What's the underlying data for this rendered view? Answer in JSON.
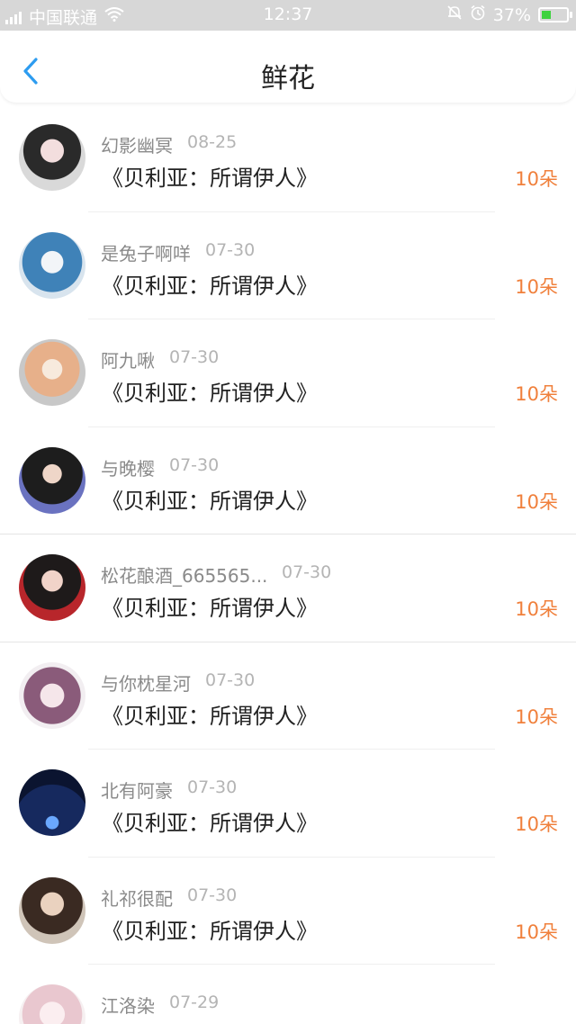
{
  "status_bar": {
    "network_type": "4G",
    "carrier": "中国联通",
    "time": "12:37",
    "battery_percent": "37%",
    "battery_level": 0.37,
    "icons": [
      "signal-icon",
      "wifi-icon",
      "mute-bell-icon",
      "alarm-icon",
      "battery-icon"
    ]
  },
  "nav": {
    "title": "鲜花",
    "back_icon": "chevron-left-icon",
    "accent_color": "#2d9cf0"
  },
  "colors": {
    "quantity": "#f0803c",
    "name": "#8a8a8a",
    "date": "#b4b4b4"
  },
  "entries": [
    {
      "name": "幻影幽冥",
      "date": "08-25",
      "gift": "《贝利亚：所谓伊人》",
      "quantity": "10朵"
    },
    {
      "name": "是兔子啊咩",
      "date": "07-30",
      "gift": "《贝利亚：所谓伊人》",
      "quantity": "10朵"
    },
    {
      "name": "阿九啾",
      "date": "07-30",
      "gift": "《贝利亚：所谓伊人》",
      "quantity": "10朵"
    },
    {
      "name": "与晚樱",
      "date": "07-30",
      "gift": "《贝利亚：所谓伊人》",
      "quantity": "10朵"
    },
    {
      "name": "松花酿酒_665565...",
      "date": "07-30",
      "gift": "《贝利亚：所谓伊人》",
      "quantity": "10朵"
    },
    {
      "name": "与你枕星河",
      "date": "07-30",
      "gift": "《贝利亚：所谓伊人》",
      "quantity": "10朵"
    },
    {
      "name": "北有阿豪",
      "date": "07-30",
      "gift": "《贝利亚：所谓伊人》",
      "quantity": "10朵"
    },
    {
      "name": "礼祁很配",
      "date": "07-30",
      "gift": "《贝利亚：所谓伊人》",
      "quantity": "10朵"
    },
    {
      "name": "江洛染",
      "date": "07-29",
      "gift": "",
      "quantity": ""
    }
  ]
}
